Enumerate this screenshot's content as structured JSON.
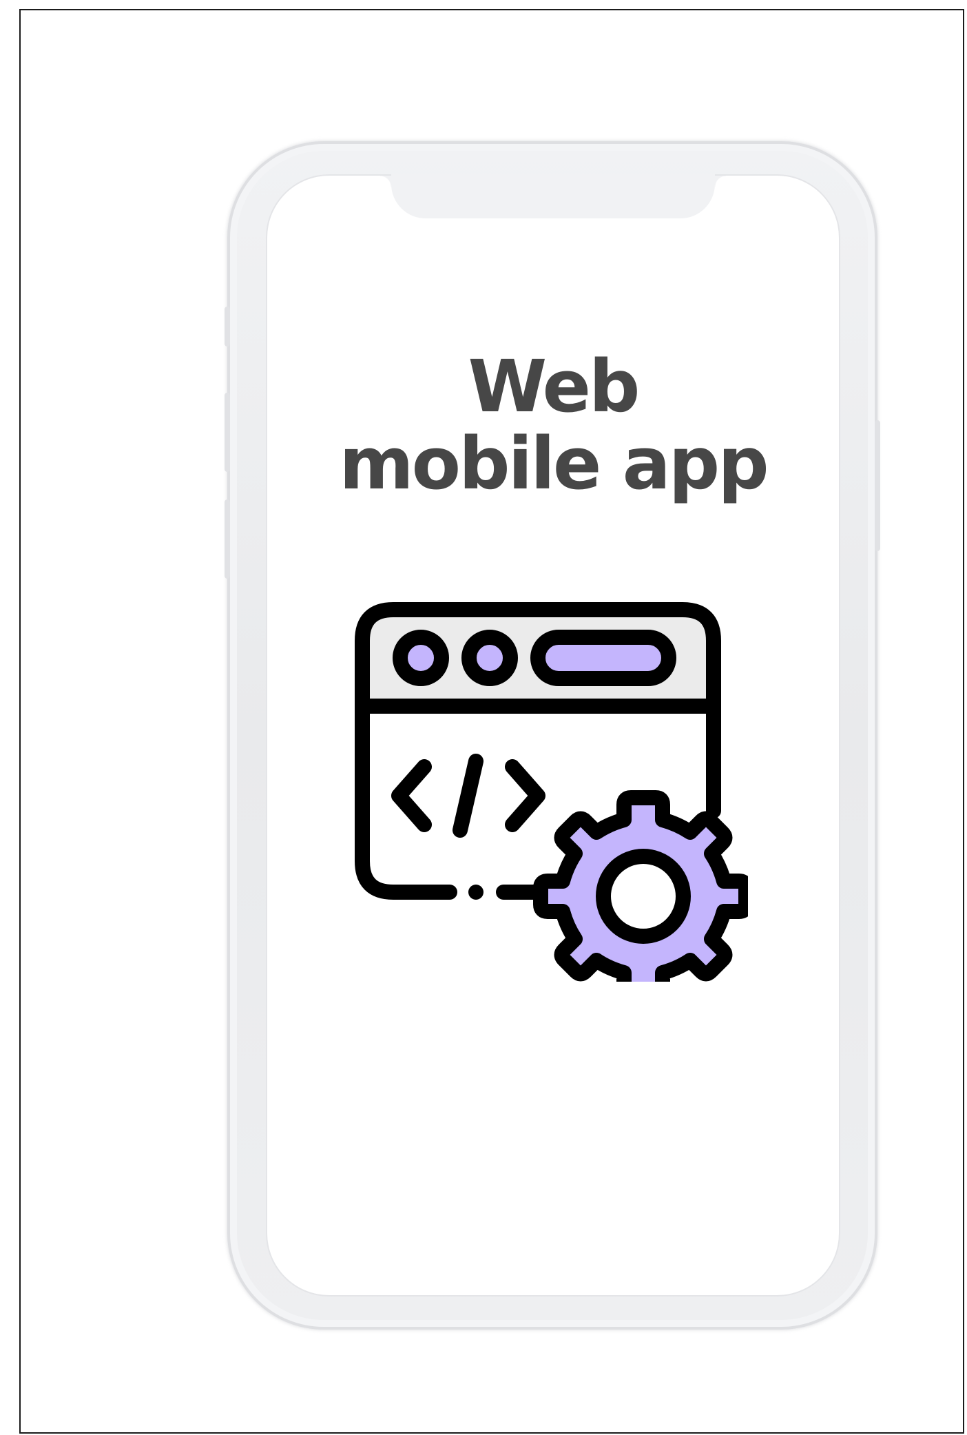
{
  "title": {
    "line1": "Web",
    "line2": "mobile app"
  },
  "colors": {
    "accent": "#c4b5fd",
    "title_text": "#474747",
    "outline": "#000000",
    "window_header": "#ebebeb",
    "phone_frame": "#eeeff1"
  },
  "icons": {
    "illustration": "web-code-settings-icon"
  }
}
